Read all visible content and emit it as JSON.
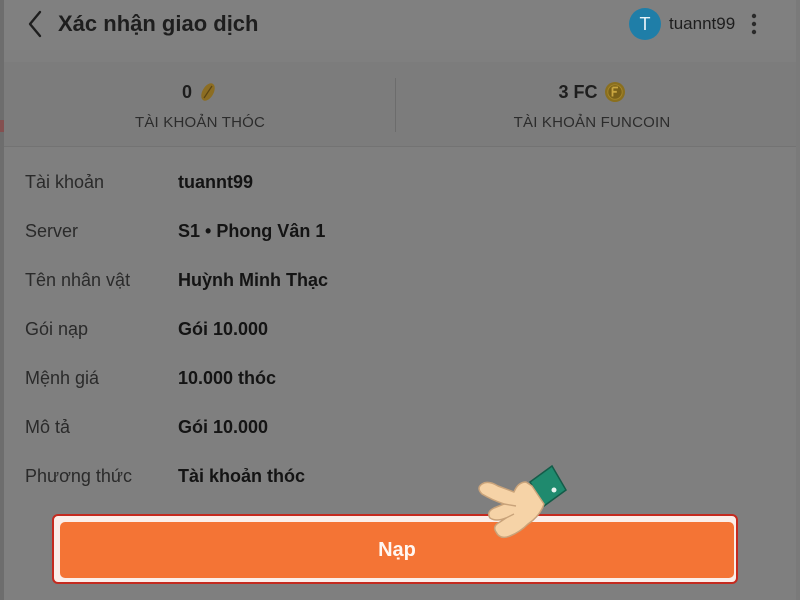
{
  "header": {
    "title": "Xác nhận giao dịch",
    "user": {
      "avatar_letter": "T",
      "username": "tuannt99"
    }
  },
  "balances": [
    {
      "value": "0",
      "label": "TÀI KHOẢN THÓC",
      "icon": "grain-icon"
    },
    {
      "value": "3 FC",
      "label": "TÀI KHOẢN FUNCOIN",
      "icon": "funcoin-icon"
    }
  ],
  "details": [
    {
      "key": "Tài khoản",
      "value": "tuannt99"
    },
    {
      "key": "Server",
      "value": "S1 • Phong Vân 1"
    },
    {
      "key": "Tên nhân vật",
      "value": "Huỳnh Minh Thạc"
    },
    {
      "key": "Gói nạp",
      "value": "Gói 10.000"
    },
    {
      "key": "Mệnh giá",
      "value": "10.000 thóc"
    },
    {
      "key": "Mô tả",
      "value": "Gói 10.000"
    },
    {
      "key": "Phương thức",
      "value": "Tài khoản thóc"
    }
  ],
  "action": {
    "label": "Nạp"
  },
  "colors": {
    "overlay": "#7f7f7f",
    "accent": "#f47435",
    "highlight_border": "#c42a1f",
    "avatar": "#1f7ea8"
  }
}
